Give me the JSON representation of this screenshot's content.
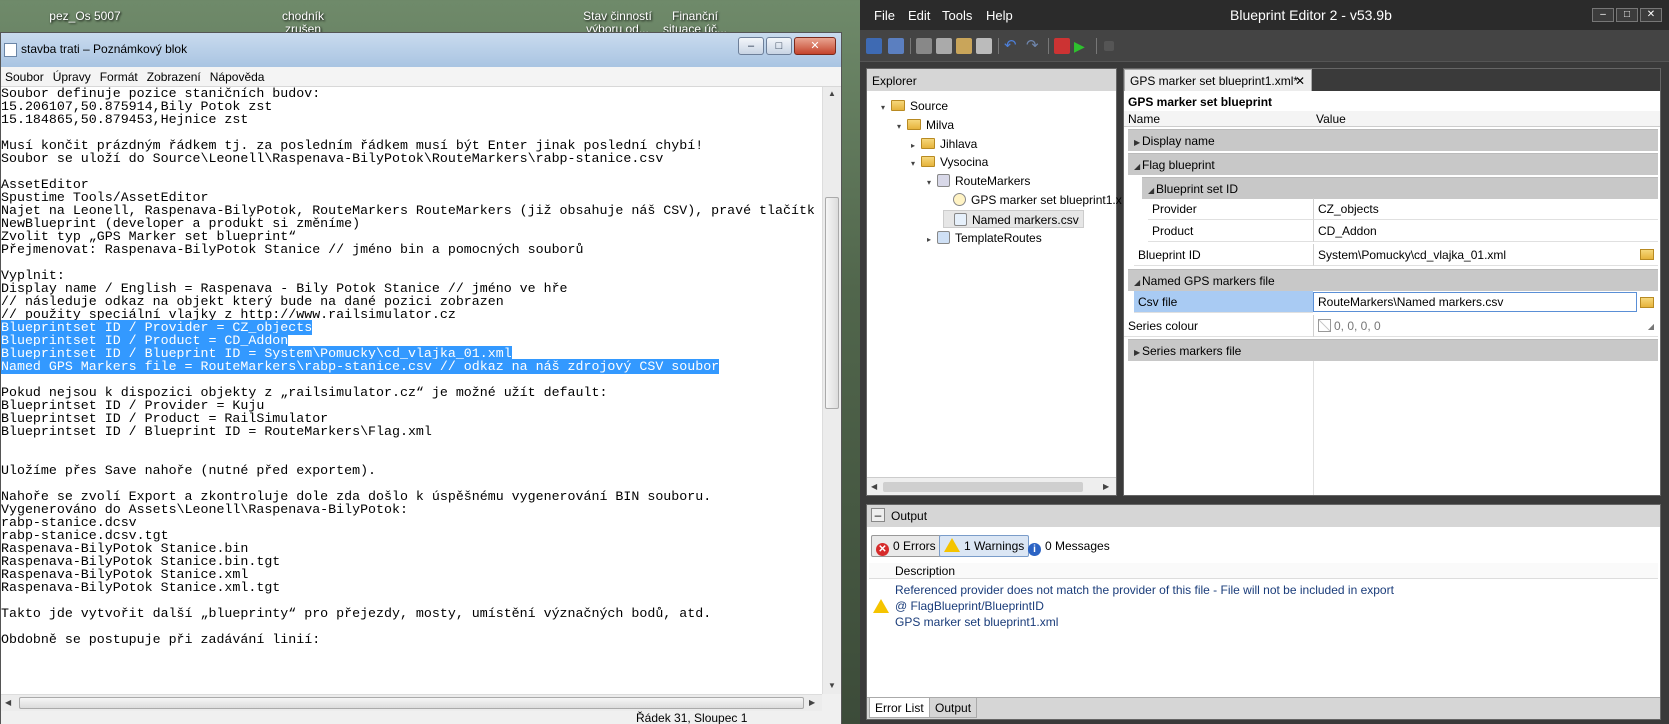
{
  "desktop": {
    "icons": [
      {
        "label": "pez_Os 5007"
      },
      {
        "label": "chodník zrušen"
      },
      {
        "label": "Stav činností výboru od..."
      },
      {
        "label": "Finanční situace úč..."
      }
    ]
  },
  "notepad": {
    "title": "stavba trati – Poznámkový blok",
    "menu": [
      "Soubor",
      "Úpravy",
      "Formát",
      "Zobrazení",
      "Nápověda"
    ],
    "lines": [
      {
        "text": "Soubor definuje pozice staničních budov:",
        "sel": false
      },
      {
        "text": "15.206107,50.875914,Bily Potok zst",
        "sel": false
      },
      {
        "text": "15.184865,50.879453,Hejnice zst",
        "sel": false
      },
      {
        "text": "",
        "sel": false
      },
      {
        "text": "Musí končit prázdným řádkem tj. za posledním řádkem musí být Enter jinak poslední chybí!",
        "sel": false
      },
      {
        "text": "Soubor se uloží do Source\\Leonell\\Raspenava-BilyPotok\\RouteMarkers\\rabp-stanice.csv",
        "sel": false
      },
      {
        "text": "",
        "sel": false
      },
      {
        "text": "AssetEditor",
        "sel": false
      },
      {
        "text": "Spustime Tools/AssetEditor",
        "sel": false
      },
      {
        "text": "Najet na Leonell, Raspenava-BilyPotok, RouteMarkers RouteMarkers (již obsahuje náš CSV), pravé tlačítk",
        "sel": false
      },
      {
        "text": "NewBlueprint (developer a produkt si změníme)",
        "sel": false
      },
      {
        "text": "Zvolit typ „GPS Marker set blueprint“",
        "sel": false
      },
      {
        "text": "Přejmenovat: Raspenava-BilyPotok Stanice // jméno bin a pomocných souborů",
        "sel": false
      },
      {
        "text": "",
        "sel": false
      },
      {
        "text": "Vyplnit:",
        "sel": false
      },
      {
        "text": "Display name / English = Raspenava - Bily Potok Stanice // jméno ve hře",
        "sel": false
      },
      {
        "text": "// následuje odkaz na objekt který bude na dané pozici zobrazen",
        "sel": false
      },
      {
        "text": "// použity speciální vlajky z http://www.railsimulator.cz",
        "sel": false
      },
      {
        "text": "Blueprintset ID / Provider = CZ_objects",
        "sel": true
      },
      {
        "text": "Blueprintset ID / Product = CD_Addon",
        "sel": true
      },
      {
        "text": "Blueprintset ID / Blueprint ID = System\\Pomucky\\cd_vlajka_01.xml",
        "sel": true
      },
      {
        "text": "Named GPS Markers file = RouteMarkers\\rabp-stanice.csv // odkaz na náš zdrojový CSV soubor",
        "sel": true
      },
      {
        "text": "",
        "sel": false
      },
      {
        "text": "Pokud nejsou k dispozici objekty z „railsimulator.cz“ je možné užít default:",
        "sel": false
      },
      {
        "text": "Blueprintset ID / Provider = Kuju",
        "sel": false
      },
      {
        "text": "Blueprintset ID / Product = RailSimulator",
        "sel": false
      },
      {
        "text": "Blueprintset ID / Blueprint ID = RouteMarkers\\Flag.xml",
        "sel": false
      },
      {
        "text": "",
        "sel": false
      },
      {
        "text": "",
        "sel": false
      },
      {
        "text": "Uložíme přes Save nahoře (nutné před exportem).",
        "sel": false
      },
      {
        "text": "",
        "sel": false
      },
      {
        "text": "Nahoře se zvolí Export a zkontroluje dole zda došlo k úspěšnému vygenerování BIN souboru.",
        "sel": false
      },
      {
        "text": "Vygenerováno do Assets\\Leonell\\Raspenava-BilyPotok:",
        "sel": false
      },
      {
        "text": "rabp-stanice.dcsv",
        "sel": false
      },
      {
        "text": "rabp-stanice.dcsv.tgt",
        "sel": false
      },
      {
        "text": "Raspenava-BilyPotok Stanice.bin",
        "sel": false
      },
      {
        "text": "Raspenava-BilyPotok Stanice.bin.tgt",
        "sel": false
      },
      {
        "text": "Raspenava-BilyPotok Stanice.xml",
        "sel": false
      },
      {
        "text": "Raspenava-BilyPotok Stanice.xml.tgt",
        "sel": false
      },
      {
        "text": "",
        "sel": false
      },
      {
        "text": "Takto jde vytvořit další „blueprinty“ pro přejezdy, mosty, umístění význačných bodů, atd.",
        "sel": false
      },
      {
        "text": "",
        "sel": false
      },
      {
        "text": "Obdobně se postupuje při zadávání linií:",
        "sel": false
      }
    ],
    "status": "Řádek 31, Sloupec 1"
  },
  "editor": {
    "title": "Blueprint Editor 2 - v53.9b",
    "menu": [
      "File",
      "Edit",
      "Tools",
      "Help"
    ],
    "explorer": {
      "header": "Explorer",
      "items": [
        {
          "label": "Source",
          "kind": "folder",
          "level": 0,
          "exp": "▾"
        },
        {
          "label": "Milva",
          "kind": "folder",
          "level": 1,
          "exp": "▾"
        },
        {
          "label": "Jihlava",
          "kind": "folder",
          "level": 2,
          "exp": "▸"
        },
        {
          "label": "Vysocina",
          "kind": "folder",
          "level": 2,
          "exp": "▾"
        },
        {
          "label": "RouteMarkers",
          "kind": "routemarkers",
          "level": 3,
          "exp": "▾"
        },
        {
          "label": "GPS marker set blueprint1.x",
          "kind": "gps",
          "level": 4,
          "exp": ""
        },
        {
          "label": "Named markers.csv",
          "kind": "csv",
          "level": 4,
          "exp": ""
        },
        {
          "label": "TemplateRoutes",
          "kind": "template",
          "level": 3,
          "exp": "▸"
        }
      ]
    },
    "props": {
      "tab_label": "GPS marker set blueprint1.xml*",
      "tab_close": "✕",
      "panel_title": "GPS marker set blueprint",
      "col_name": "Name",
      "col_value": "Value",
      "display_name": "Display name",
      "flag_blueprint": "Flag blueprint",
      "blueprint_set_id": "Blueprint set ID",
      "provider_label": "Provider",
      "provider_value": "CZ_objects",
      "product_label": "Product",
      "product_value": "CD_Addon",
      "blueprint_id_label": "Blueprint ID",
      "blueprint_id_value": "System\\Pomucky\\cd_vlajka_01.xml",
      "named_gps": "Named GPS markers file",
      "csv_label": "Csv file",
      "csv_value": "RouteMarkers\\Named markers.csv",
      "series_colour_label": "Series colour",
      "series_colour_value": "0, 0, 0, 0",
      "series_markers": "Series markers file"
    },
    "output": {
      "header": "Output",
      "errors": "0 Errors",
      "warnings": "1 Warnings",
      "messages": "0 Messages",
      "col_description": "Description",
      "entry_line1": "Referenced provider does not match the provider of this file - File will not be included in export",
      "entry_line2": "@ FlagBlueprint/BlueprintID",
      "entry_line3": "GPS marker set blueprint1.xml",
      "tab_error_list": "Error List",
      "tab_output": "Output"
    }
  },
  "colors": {
    "selection": "#3399ff",
    "highlight_row": "#a9cbf3"
  }
}
